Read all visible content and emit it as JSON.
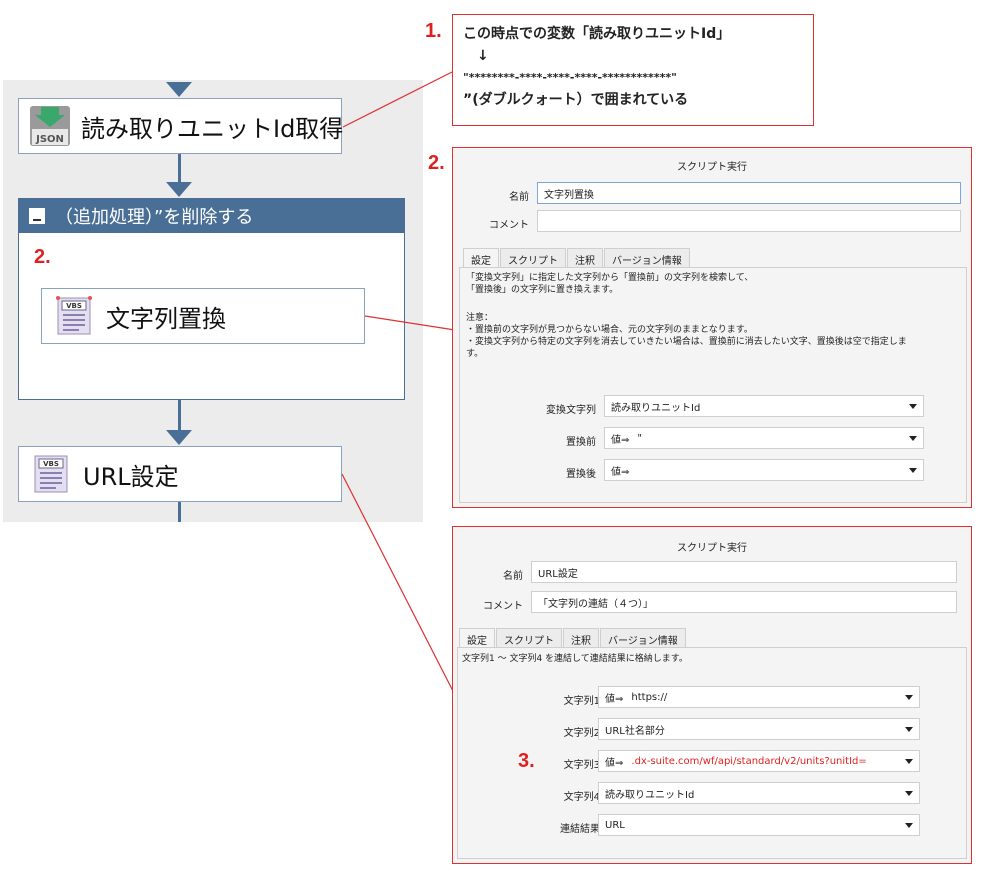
{
  "flow": {
    "node_json": {
      "icon_text": "JSON",
      "label": "読み取りユニットId取得"
    },
    "group": {
      "title": "（追加処理）”を削除する",
      "step_number": "2."
    },
    "node_replace": {
      "icon_text": "VBS",
      "label": "文字列置換"
    },
    "node_url": {
      "icon_text": "VBS",
      "label": "URL設定"
    }
  },
  "callout1": {
    "number": "1.",
    "line1": "この時点での変数「読み取りユニットId」",
    "arrow": "↓",
    "line2": "\"********-****-****-****-************\"",
    "line3": "”(ダブルクォート）で囲まれている"
  },
  "dialog_replace": {
    "number": "2.",
    "title": "スクリプト実行",
    "name_label": "名前",
    "name_value": "文字列置換",
    "comment_label": "コメント",
    "comment_value": "",
    "tabs": [
      "設定",
      "スクリプト",
      "注釈",
      "バージョン情報"
    ],
    "description": [
      "「変換文字列」に指定した文字列から「置換前」の文字列を検索して、",
      "「置換後」の文字列に置き換えます。",
      "",
      "注意：",
      "・置換前の文字列が見つからない場合、元の文字列のままとなります。",
      "・変換文字列から特定の文字列を消去していきたい場合は、置換前に消去したい文字、置換後は空で指定しま",
      "す。"
    ],
    "fields": [
      {
        "label": "変換文字列",
        "prefix": "",
        "value": "読み取りユニットId"
      },
      {
        "label": "置換前",
        "prefix": "値⇒",
        "value": "\""
      },
      {
        "label": "置換後",
        "prefix": "値⇒",
        "value": ""
      }
    ]
  },
  "dialog_url": {
    "title": "スクリプト実行",
    "name_label": "名前",
    "name_value": "URL設定",
    "comment_label": "コメント",
    "comment_value": "「文字列の連結（４つ）」",
    "tabs": [
      "設定",
      "スクリプト",
      "注釈",
      "バージョン情報"
    ],
    "description": [
      "文字列1 〜 文字列4 を連結して連結結果に格納します。"
    ],
    "step_number": "3.",
    "fields": [
      {
        "label": "文字列1",
        "prefix": "値⇒",
        "value": "https://"
      },
      {
        "label": "文字列2",
        "prefix": "",
        "value": "URL社名部分"
      },
      {
        "label": "文字列3",
        "prefix": "値⇒",
        "value": ".dx-suite.com/wf/api/standard/v2/units?unitId="
      },
      {
        "label": "文字列4",
        "prefix": "",
        "value": "読み取りユニットId"
      },
      {
        "label": "連結結果",
        "prefix": "",
        "value": "URL"
      }
    ]
  },
  "colors": {
    "accent_red": "#e02020",
    "flow_blue": "#4a6f96"
  }
}
